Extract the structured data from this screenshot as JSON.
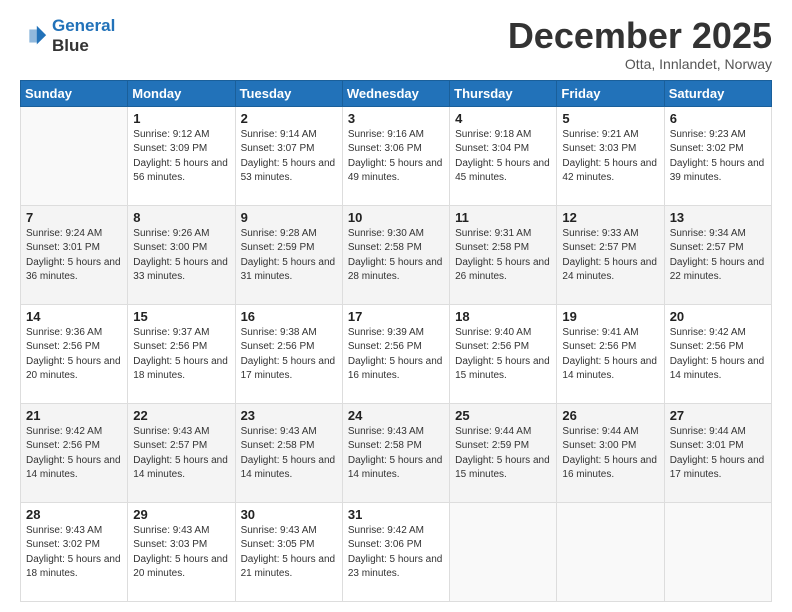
{
  "header": {
    "logo_line1": "General",
    "logo_line2": "Blue",
    "month": "December 2025",
    "location": "Otta, Innlandet, Norway"
  },
  "weekdays": [
    "Sunday",
    "Monday",
    "Tuesday",
    "Wednesday",
    "Thursday",
    "Friday",
    "Saturday"
  ],
  "weeks": [
    [
      {
        "day": "",
        "info": ""
      },
      {
        "day": "1",
        "info": "Sunrise: 9:12 AM\nSunset: 3:09 PM\nDaylight: 5 hours\nand 56 minutes."
      },
      {
        "day": "2",
        "info": "Sunrise: 9:14 AM\nSunset: 3:07 PM\nDaylight: 5 hours\nand 53 minutes."
      },
      {
        "day": "3",
        "info": "Sunrise: 9:16 AM\nSunset: 3:06 PM\nDaylight: 5 hours\nand 49 minutes."
      },
      {
        "day": "4",
        "info": "Sunrise: 9:18 AM\nSunset: 3:04 PM\nDaylight: 5 hours\nand 45 minutes."
      },
      {
        "day": "5",
        "info": "Sunrise: 9:21 AM\nSunset: 3:03 PM\nDaylight: 5 hours\nand 42 minutes."
      },
      {
        "day": "6",
        "info": "Sunrise: 9:23 AM\nSunset: 3:02 PM\nDaylight: 5 hours\nand 39 minutes."
      }
    ],
    [
      {
        "day": "7",
        "info": "Sunrise: 9:24 AM\nSunset: 3:01 PM\nDaylight: 5 hours\nand 36 minutes."
      },
      {
        "day": "8",
        "info": "Sunrise: 9:26 AM\nSunset: 3:00 PM\nDaylight: 5 hours\nand 33 minutes."
      },
      {
        "day": "9",
        "info": "Sunrise: 9:28 AM\nSunset: 2:59 PM\nDaylight: 5 hours\nand 31 minutes."
      },
      {
        "day": "10",
        "info": "Sunrise: 9:30 AM\nSunset: 2:58 PM\nDaylight: 5 hours\nand 28 minutes."
      },
      {
        "day": "11",
        "info": "Sunrise: 9:31 AM\nSunset: 2:58 PM\nDaylight: 5 hours\nand 26 minutes."
      },
      {
        "day": "12",
        "info": "Sunrise: 9:33 AM\nSunset: 2:57 PM\nDaylight: 5 hours\nand 24 minutes."
      },
      {
        "day": "13",
        "info": "Sunrise: 9:34 AM\nSunset: 2:57 PM\nDaylight: 5 hours\nand 22 minutes."
      }
    ],
    [
      {
        "day": "14",
        "info": "Sunrise: 9:36 AM\nSunset: 2:56 PM\nDaylight: 5 hours\nand 20 minutes."
      },
      {
        "day": "15",
        "info": "Sunrise: 9:37 AM\nSunset: 2:56 PM\nDaylight: 5 hours\nand 18 minutes."
      },
      {
        "day": "16",
        "info": "Sunrise: 9:38 AM\nSunset: 2:56 PM\nDaylight: 5 hours\nand 17 minutes."
      },
      {
        "day": "17",
        "info": "Sunrise: 9:39 AM\nSunset: 2:56 PM\nDaylight: 5 hours\nand 16 minutes."
      },
      {
        "day": "18",
        "info": "Sunrise: 9:40 AM\nSunset: 2:56 PM\nDaylight: 5 hours\nand 15 minutes."
      },
      {
        "day": "19",
        "info": "Sunrise: 9:41 AM\nSunset: 2:56 PM\nDaylight: 5 hours\nand 14 minutes."
      },
      {
        "day": "20",
        "info": "Sunrise: 9:42 AM\nSunset: 2:56 PM\nDaylight: 5 hours\nand 14 minutes."
      }
    ],
    [
      {
        "day": "21",
        "info": "Sunrise: 9:42 AM\nSunset: 2:56 PM\nDaylight: 5 hours\nand 14 minutes."
      },
      {
        "day": "22",
        "info": "Sunrise: 9:43 AM\nSunset: 2:57 PM\nDaylight: 5 hours\nand 14 minutes."
      },
      {
        "day": "23",
        "info": "Sunrise: 9:43 AM\nSunset: 2:58 PM\nDaylight: 5 hours\nand 14 minutes."
      },
      {
        "day": "24",
        "info": "Sunrise: 9:43 AM\nSunset: 2:58 PM\nDaylight: 5 hours\nand 14 minutes."
      },
      {
        "day": "25",
        "info": "Sunrise: 9:44 AM\nSunset: 2:59 PM\nDaylight: 5 hours\nand 15 minutes."
      },
      {
        "day": "26",
        "info": "Sunrise: 9:44 AM\nSunset: 3:00 PM\nDaylight: 5 hours\nand 16 minutes."
      },
      {
        "day": "27",
        "info": "Sunrise: 9:44 AM\nSunset: 3:01 PM\nDaylight: 5 hours\nand 17 minutes."
      }
    ],
    [
      {
        "day": "28",
        "info": "Sunrise: 9:43 AM\nSunset: 3:02 PM\nDaylight: 5 hours\nand 18 minutes."
      },
      {
        "day": "29",
        "info": "Sunrise: 9:43 AM\nSunset: 3:03 PM\nDaylight: 5 hours\nand 20 minutes."
      },
      {
        "day": "30",
        "info": "Sunrise: 9:43 AM\nSunset: 3:05 PM\nDaylight: 5 hours\nand 21 minutes."
      },
      {
        "day": "31",
        "info": "Sunrise: 9:42 AM\nSunset: 3:06 PM\nDaylight: 5 hours\nand 23 minutes."
      },
      {
        "day": "",
        "info": ""
      },
      {
        "day": "",
        "info": ""
      },
      {
        "day": "",
        "info": ""
      }
    ]
  ]
}
